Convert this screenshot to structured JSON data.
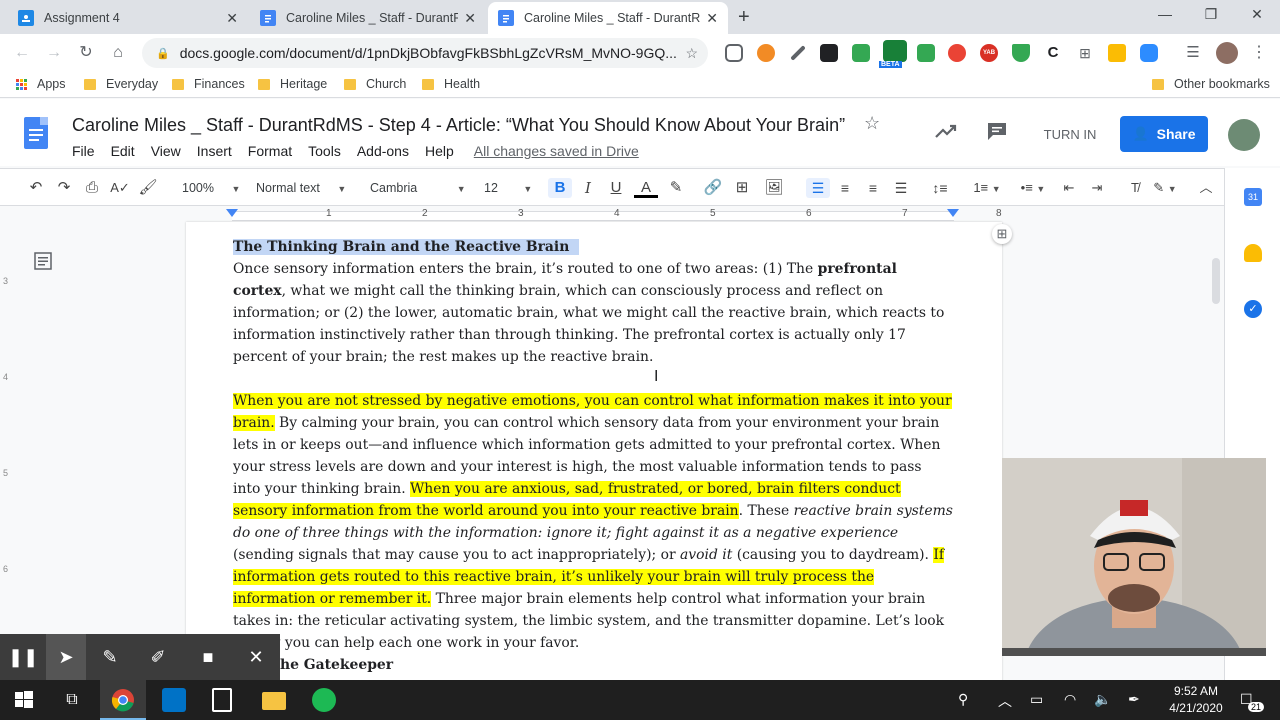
{
  "browser": {
    "tabs": [
      {
        "title": "Assignment 4",
        "close": "✕"
      },
      {
        "title": "Caroline Miles _ Staff - DurantRd",
        "close": "✕"
      },
      {
        "title": "Caroline Miles _ Staff - DurantRd",
        "close": "✕"
      }
    ],
    "new_tab": "+",
    "window_controls": {
      "minimize": "—",
      "restore": "❐",
      "close": "✕"
    },
    "url": "docs.google.com/document/d/1pnDkjBObfavgFkBSbhLgZcVRsM_MvNO-9GQ...",
    "bookmarks": [
      "Apps",
      "Everyday",
      "Finances",
      "Heritage",
      "Church",
      "Health"
    ],
    "other_bookmarks": "Other bookmarks",
    "extension_badge": "BETA",
    "extension_label": "YAB"
  },
  "docs": {
    "title": "Caroline Miles _ Staff - DurantRdMS - Step 4 -  Article: “What You Should Know About Your Brain”",
    "menu": [
      "File",
      "Edit",
      "View",
      "Insert",
      "Format",
      "Tools",
      "Add-ons",
      "Help"
    ],
    "saved_status": "All changes saved in Drive",
    "turn_in": "TURN IN",
    "share": "Share",
    "toolbar": {
      "zoom": "100%",
      "style": "Normal text",
      "font": "Cambria",
      "size": "12",
      "bold": "B",
      "italic": "I",
      "underline": "U",
      "text_color": "A"
    },
    "ruler_numbers": [
      "1",
      "2",
      "3",
      "4",
      "5",
      "6",
      "7",
      "8"
    ],
    "vertical_ruler_numbers": [
      "3",
      "4",
      "5",
      "6"
    ]
  },
  "content": {
    "heading": "The Thinking Brain and the Reactive Brain",
    "p1": {
      "a": "Once sensory information enters the brain, it’s routed to one of two areas: (1) The ",
      "b": "prefrontal cortex",
      "c": ", what we might call the thinking brain, which can consciously process and reflect on information; or (2) the lower, automatic brain, what we might call the reactive brain, which reacts to information instinc­tively rather than through thinking. The prefrontal cortex is actually only 17 percent of your brain; the rest makes up the reactive brain."
    },
    "p2": {
      "h1": "When you are not stressed by negative emotions, you can control what information makes it into your brain.",
      "t1": " By calming your brain, you can control which sensory data from your environment your brain lets in or keeps out—and influence which information gets admitted to your prefrontal cortex.  When your stress levels are down and your interest is high,  the most valuable information tends to pass into your thinking brain. ",
      "h2": "When you are anxious, sad, frustrated, or bored, brain filters conduct sensory information from the world around you into your reactive brain",
      "t2": ". These ",
      "i1": "reactive brain systems do one of three things with the information: ignore it; fight against it as a negative experience",
      "t3": " (sending signals that may cause you to act inappropriately); or ",
      "i2": "avoid it",
      "t4": " (causing you to daydream). ",
      "h3": "If information gets routed to this reactive brain, it’s unlikely your brain will truly process the information or remember it.",
      "t5": "  Three major brain elements help control what information your brain takes in: the reticular activating system, the limbic system, and the transmitter dopamine. Let’s look at how you can help each one work in your favor."
    },
    "next_heading": "he Gatekeeper"
  },
  "taskbar": {
    "time": "9:52 AM",
    "date": "4/21/2020",
    "notifications": "21"
  },
  "colors": {
    "accent": "#1a73e8",
    "highlight": "#ffff00",
    "selection": "#c2d6f5"
  }
}
